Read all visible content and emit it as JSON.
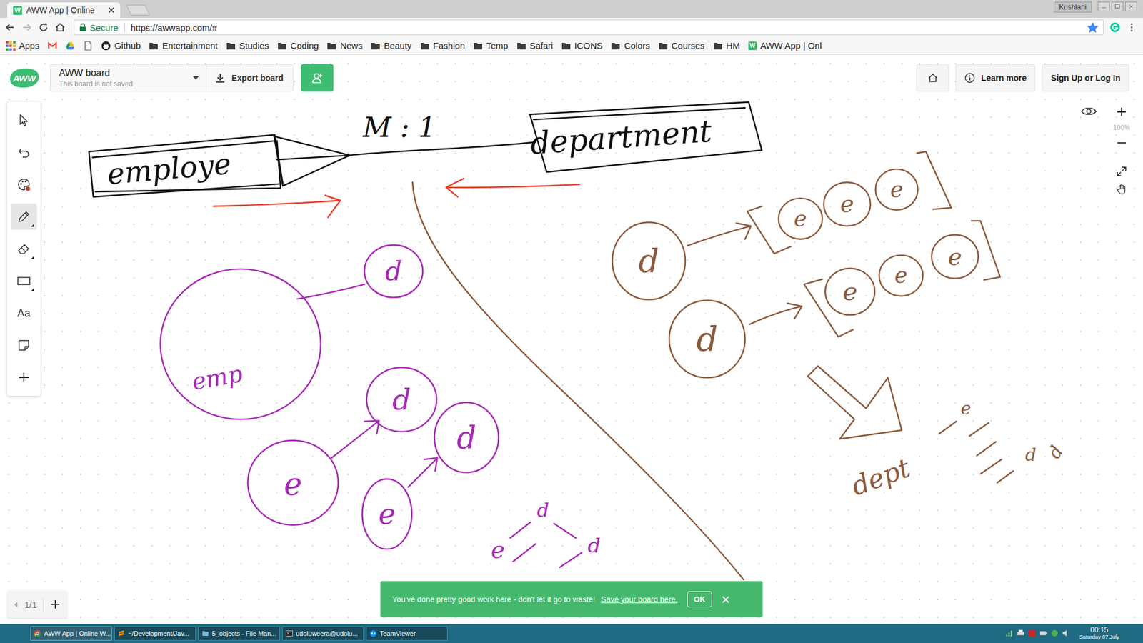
{
  "browser": {
    "tab": {
      "title": "AWW App | Online",
      "favicon": "W"
    },
    "user": "Kushlani",
    "secure_label": "Secure",
    "url": "https://awwapp.com/#",
    "bookmarked": true,
    "bookmarks": [
      {
        "kind": "apps",
        "label": "Apps"
      },
      {
        "kind": "gmail"
      },
      {
        "kind": "drive"
      },
      {
        "kind": "doc"
      },
      {
        "kind": "github",
        "label": "Github"
      },
      {
        "kind": "folder",
        "label": "Entertainment"
      },
      {
        "kind": "folder",
        "label": "Studies"
      },
      {
        "kind": "folder",
        "label": "Coding"
      },
      {
        "kind": "folder",
        "label": "News"
      },
      {
        "kind": "folder",
        "label": "Beauty"
      },
      {
        "kind": "folder",
        "label": "Fashion"
      },
      {
        "kind": "folder",
        "label": "Temp"
      },
      {
        "kind": "folder",
        "label": "Safari"
      },
      {
        "kind": "folder",
        "label": "ICONS"
      },
      {
        "kind": "folder",
        "label": "Colors"
      },
      {
        "kind": "folder",
        "label": "Courses"
      },
      {
        "kind": "folder",
        "label": "HM"
      },
      {
        "kind": "aww",
        "label": "AWW App | Onl"
      }
    ]
  },
  "app": {
    "logo": "AWW",
    "board_name": "AWW board",
    "board_status": "This board is not saved",
    "export": "Export board",
    "learn_more": "Learn more",
    "sign_in": "Sign Up or Log In",
    "zoom": "100%",
    "page": "1/1",
    "tools": [
      {
        "kind": "select",
        "selected": false
      },
      {
        "kind": "undo",
        "selected": false
      },
      {
        "kind": "palette",
        "selected": false
      },
      {
        "kind": "pen",
        "selected": true
      },
      {
        "kind": "eraser",
        "selected": false
      },
      {
        "kind": "shape",
        "selected": false
      },
      {
        "kind": "text",
        "label": "Aa",
        "selected": false
      },
      {
        "kind": "note",
        "selected": false
      },
      {
        "kind": "add",
        "selected": false
      }
    ]
  },
  "canvas": {
    "labels": [
      {
        "text": "M : 1",
        "color": "#111111"
      },
      {
        "text": "employe",
        "color": "#111111"
      },
      {
        "text": "department",
        "color": "#111111"
      },
      {
        "text": "emp",
        "color": "#a62bb5"
      },
      {
        "text": "d",
        "color": "#a62bb5"
      },
      {
        "text": "e",
        "color": "#a62bb5"
      },
      {
        "text": "d",
        "color": "#a62bb5"
      },
      {
        "text": "d",
        "color": "#a62bb5"
      },
      {
        "text": "e",
        "color": "#a62bb5"
      },
      {
        "text": "e",
        "color": "#a62bb5"
      },
      {
        "text": "d",
        "color": "#a62bb5"
      },
      {
        "text": "d",
        "color": "#a62bb5"
      },
      {
        "text": "d",
        "color": "#8b5a3c"
      },
      {
        "text": "e",
        "color": "#8b5a3c"
      },
      {
        "text": "e",
        "color": "#8b5a3c"
      },
      {
        "text": "e",
        "color": "#8b5a3c"
      },
      {
        "text": "d",
        "color": "#8b5a3c"
      },
      {
        "text": "e",
        "color": "#8b5a3c"
      },
      {
        "text": "e",
        "color": "#8b5a3c"
      },
      {
        "text": "e",
        "color": "#8b5a3c"
      },
      {
        "text": "dept",
        "color": "#8b5a3c"
      },
      {
        "text": "e",
        "color": "#8b5a3c"
      },
      {
        "text": "d",
        "color": "#8b5a3c"
      },
      {
        "text": "d",
        "color": "#8b5a3c"
      }
    ]
  },
  "toast": {
    "message": "You've done pretty good work here - don't let it go to waste!",
    "link": "Save your board here.",
    "button": "OK"
  },
  "taskbar": {
    "items": [
      {
        "kind": "chrome",
        "label": "AWW App | Online W...",
        "active": true
      },
      {
        "kind": "editor",
        "label": "~/Development/Jav...",
        "active": false
      },
      {
        "kind": "folder",
        "label": "5_objects - File Man...",
        "active": false
      },
      {
        "kind": "terminal",
        "label": "udoluweera@udolu...",
        "active": false
      },
      {
        "kind": "teamviewer",
        "label": "TeamViewer",
        "active": false
      }
    ],
    "time": "00:15",
    "date": "Saturday 07 July"
  }
}
